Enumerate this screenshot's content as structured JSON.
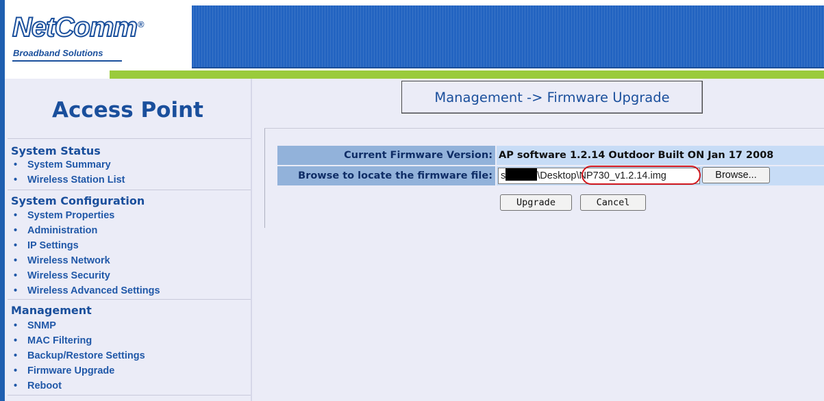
{
  "brand": {
    "logo_text": "NetComm",
    "logo_registered": "®",
    "tagline": "Broadband Solutions",
    "colors": {
      "primary_blue": "#2364c1",
      "green_accent": "#9acb3c",
      "panel_bg": "#ebecf7",
      "highlight_red": "#d1161c"
    }
  },
  "sidebar": {
    "title": "Access Point",
    "sections": [
      {
        "heading": "System Status",
        "items": [
          "System Summary",
          "Wireless Station List"
        ]
      },
      {
        "heading": "System Configuration",
        "items": [
          "System Properties",
          "Administration",
          "IP Settings",
          "Wireless Network",
          "Wireless Security",
          "Wireless Advanced Settings"
        ]
      },
      {
        "heading": "Management",
        "items": [
          "SNMP",
          "MAC Filtering",
          "Backup/Restore Settings",
          "Firmware Upgrade",
          "Reboot"
        ]
      }
    ]
  },
  "main": {
    "page_title": "Management -> Firmware Upgrade",
    "current_version_label": "Current Firmware Version:",
    "current_version_value": "AP software 1.2.14 Outdoor Built ON Jan 17 2008",
    "browse_label": "Browse to locate the firmware file:",
    "file_path_prefix": "s",
    "file_path_middle": "\\Desktop",
    "file_path_highlighted": "\\NP730_v1.2.14.img",
    "browse_button": "Browse...",
    "upgrade_button": "Upgrade",
    "cancel_button": "Cancel"
  }
}
